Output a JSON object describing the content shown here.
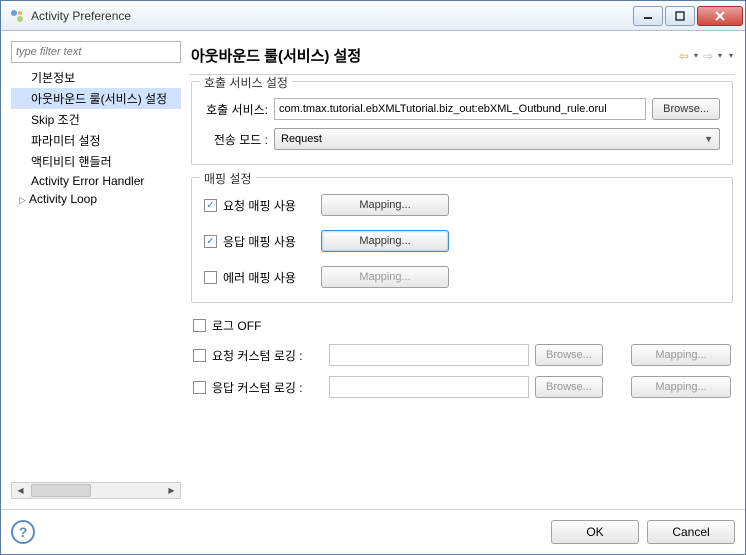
{
  "window": {
    "title": "Activity Preference"
  },
  "sidebar": {
    "filter_placeholder": "type filter text",
    "items": [
      {
        "label": "기본정보"
      },
      {
        "label": "아웃바운드 룰(서비스) 설정"
      },
      {
        "label": "Skip 조건"
      },
      {
        "label": "파라미터 설정"
      },
      {
        "label": "액티비티 핸들러"
      },
      {
        "label": "Activity Error Handler"
      },
      {
        "label": "Activity Loop"
      }
    ]
  },
  "main": {
    "title": "아웃바운드 룰(서비스) 설정",
    "call_group": {
      "label": "호출 서비스 설정",
      "service_label": "호출 서비스:",
      "service_value": "com.tmax.tutorial.ebXMLTutorial.biz_out:ebXML_Outbund_rule.orul",
      "browse": "Browse...",
      "mode_label": "전송 모드 :",
      "mode_value": "Request"
    },
    "mapping_group": {
      "label": "매핑 설정",
      "req_label": "요청 매핑 사용",
      "res_label": "응답 매핑 사용",
      "err_label": "에러 매핑 사용",
      "mapping_btn": "Mapping..."
    },
    "log": {
      "off_label": "로그 OFF",
      "req_label": "요청 커스텀 로깅 :",
      "res_label": "응답 커스텀 로깅 :",
      "browse": "Browse...",
      "mapping": "Mapping..."
    }
  },
  "footer": {
    "ok": "OK",
    "cancel": "Cancel"
  }
}
